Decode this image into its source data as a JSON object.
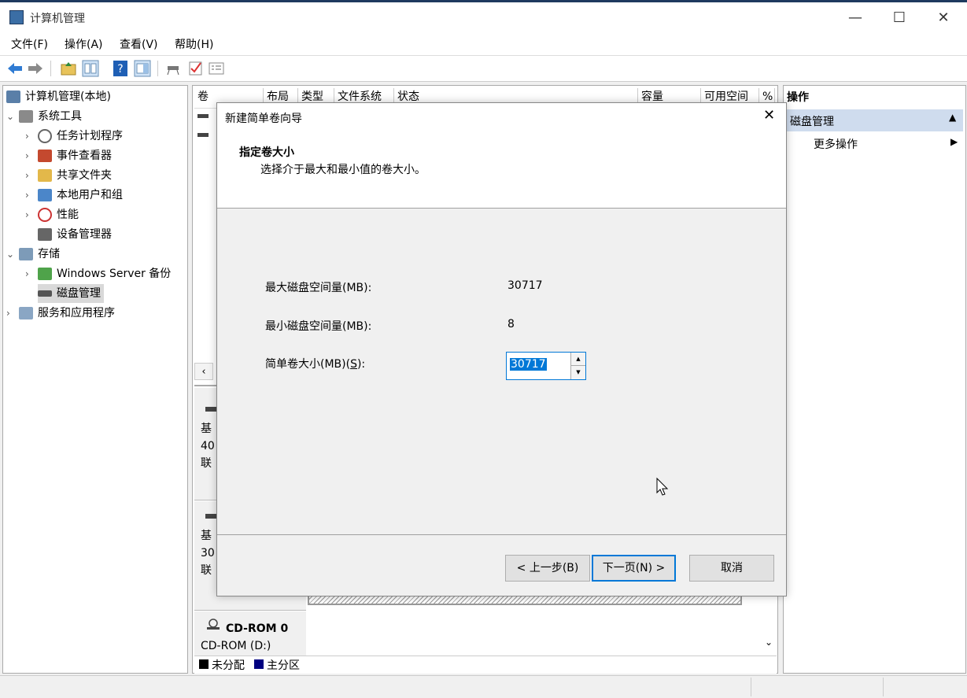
{
  "window": {
    "title": "计算机管理",
    "minimize": "—",
    "maximize": "☐",
    "close": "✕"
  },
  "menu": [
    "文件(F)",
    "操作(A)",
    "查看(V)",
    "帮助(H)"
  ],
  "tree": {
    "root": "计算机管理(本地)",
    "system_tools": "系统工具",
    "task_scheduler": "任务计划程序",
    "event_viewer": "事件查看器",
    "shared_folders": "共享文件夹",
    "local_users": "本地用户和组",
    "performance": "性能",
    "device_manager": "设备管理器",
    "storage": "存储",
    "windows_backup": "Windows Server 备份",
    "disk_management": "磁盘管理",
    "services_apps": "服务和应用程序"
  },
  "volume_columns": [
    "卷",
    "布局",
    "类型",
    "文件系统",
    "状态",
    "容量",
    "可用空间",
    "%"
  ],
  "disks": {
    "disk0": {
      "line1": "基",
      "line2": "40",
      "line3": "联"
    },
    "disk1": {
      "line1": "基",
      "line2": "30",
      "line3": "联"
    },
    "cdrom": {
      "name": "CD-ROM 0",
      "sub": "CD-ROM (D:)"
    }
  },
  "legend": {
    "unallocated": "未分配",
    "primary": "主分区",
    "unallocated_color": "#000000",
    "primary_color": "#000080"
  },
  "actions": {
    "header": "操作",
    "section": "磁盘管理",
    "more": "更多操作"
  },
  "dialog": {
    "title": "新建简单卷向导",
    "heading": "指定卷大小",
    "subheading": "选择介于最大和最小值的卷大小。",
    "max_label": "最大磁盘空间量(MB):",
    "max_value": "30717",
    "min_label": "最小磁盘空间量(MB):",
    "min_value": "8",
    "size_label": "简单卷大小(MB)(",
    "size_label_key": "S",
    "size_label_end": "):",
    "size_value": "30717",
    "back_button": "< 上一步(B)",
    "next_button": "下一页(N) >",
    "cancel_button": "取消"
  }
}
